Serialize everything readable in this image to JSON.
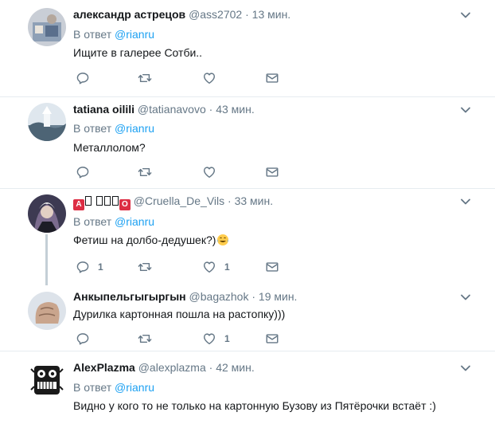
{
  "colors": {
    "link": "#1da1f2",
    "muted": "#657786",
    "text": "#14171a",
    "separator": "#e6ecf0",
    "badge_red": "#dd2e44"
  },
  "tweets": [
    {
      "name": "александр астрецов",
      "handle": "@ass2702",
      "dot": "·",
      "time": "13 мин.",
      "reply_prefix": "В ответ",
      "reply_to": "@rianru",
      "text": "Ищите в галерее Сотби..",
      "reply_count": "",
      "retweet_count": "",
      "like_count": ""
    },
    {
      "name": "tatiana oilili",
      "handle": "@tatianavovo",
      "dot": "·",
      "time": "43 мин.",
      "reply_prefix": "В ответ",
      "reply_to": "@rianru",
      "text": "Металлолом?",
      "reply_count": "",
      "retweet_count": "",
      "like_count": ""
    },
    {
      "name_badge": "A",
      "name_badge2": "O",
      "handle": "@Cruella_De_Vils",
      "dot": "·",
      "time": "33 мин.",
      "reply_prefix": "В ответ",
      "reply_to": "@rianru",
      "text": "Фетиш на долбо-дедушек?)",
      "reply_count": "1",
      "retweet_count": "",
      "like_count": "1"
    },
    {
      "name": "Анкыпельгыгыргын",
      "handle": "@bagazhok",
      "dot": "·",
      "time": "19 мин.",
      "text": "Дурилка картонная пошла на растопку)))",
      "reply_count": "",
      "retweet_count": "",
      "like_count": "1"
    },
    {
      "name": "AlexPlazma",
      "handle": "@alexplazma",
      "dot": "·",
      "time": "42 мин.",
      "reply_prefix": "В ответ",
      "reply_to": "@rianru",
      "text": "Видно у кого то не только на картонную Бузову из Пятёрочки встаёт :)"
    }
  ],
  "icons": {
    "reply": "reply-icon",
    "retweet": "retweet-icon",
    "like": "heart-icon",
    "dm": "envelope-icon",
    "caret": "chevron-down-icon",
    "emoji": "tears-of-joy-emoji"
  }
}
